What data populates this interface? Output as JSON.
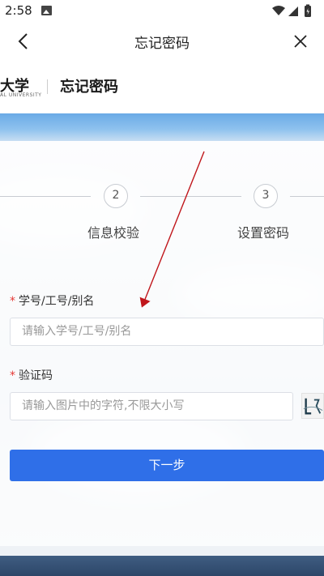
{
  "status_bar": {
    "time": "2:58"
  },
  "header": {
    "title": "忘记密码"
  },
  "brand": {
    "name": "大学",
    "name_en": "AL UNIVERSITY",
    "page_title": "忘记密码"
  },
  "steps": [
    {
      "number": "2",
      "label": "信息校验"
    },
    {
      "number": "3",
      "label": "设置密码"
    }
  ],
  "form": {
    "id_field": {
      "label": "学号/工号/别名",
      "required_mark": "*",
      "placeholder": "请输入学号/工号/别名"
    },
    "captcha_field": {
      "label": "验证码",
      "required_mark": "*",
      "placeholder": "请输入图片中的字符,不限大小写"
    },
    "next_button": "下一步"
  },
  "colors": {
    "primary": "#2f6fe8",
    "required": "#e53935",
    "annotation_arrow": "#c0161b"
  }
}
